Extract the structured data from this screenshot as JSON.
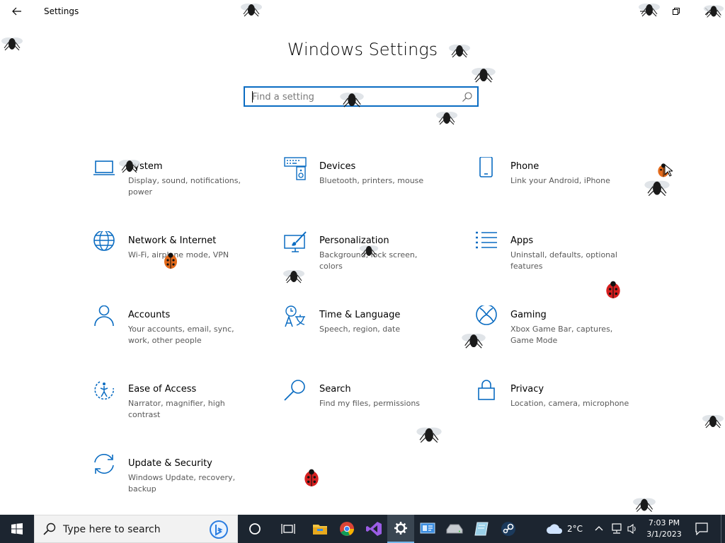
{
  "window": {
    "title": "Settings",
    "back_icon": "back-arrow-icon",
    "controls": [
      "minimize-icon",
      "restore-icon",
      "close-icon"
    ]
  },
  "main": {
    "title": "Windows Settings",
    "search": {
      "placeholder": "Find a setting",
      "value": "",
      "icon": "search-icon"
    }
  },
  "categories": [
    {
      "name": "System",
      "desc": "Display, sound, notifications, power",
      "icon": "laptop-icon"
    },
    {
      "name": "Devices",
      "desc": "Bluetooth, printers, mouse",
      "icon": "devices-icon"
    },
    {
      "name": "Phone",
      "desc": "Link your Android, iPhone",
      "icon": "phone-icon"
    },
    {
      "name": "Network & Internet",
      "desc": "Wi-Fi, airplane mode, VPN",
      "icon": "globe-icon"
    },
    {
      "name": "Personalization",
      "desc": "Background, lock screen, colors",
      "icon": "paintbrush-icon"
    },
    {
      "name": "Apps",
      "desc": "Uninstall, defaults, optional features",
      "icon": "apps-list-icon"
    },
    {
      "name": "Accounts",
      "desc": "Your accounts, email, sync, work, other people",
      "icon": "person-icon"
    },
    {
      "name": "Time & Language",
      "desc": "Speech, region, date",
      "icon": "time-language-icon"
    },
    {
      "name": "Gaming",
      "desc": "Xbox Game Bar, captures, Game Mode",
      "icon": "xbox-icon"
    },
    {
      "name": "Ease of Access",
      "desc": "Narrator, magnifier, high contrast",
      "icon": "ease-of-access-icon"
    },
    {
      "name": "Search",
      "desc": "Find my files, permissions",
      "icon": "magnifier-icon"
    },
    {
      "name": "Privacy",
      "desc": "Location, camera, microphone",
      "icon": "lock-icon"
    },
    {
      "name": "Update & Security",
      "desc": "Windows Update, recovery, backup",
      "icon": "sync-icon"
    }
  ],
  "taskbar": {
    "search_placeholder": "Type here to search",
    "pinned": [
      "cortana-icon",
      "task-view-icon",
      "file-explorer-icon",
      "chrome-icon",
      "visual-studio-icon",
      "settings-gear-icon",
      "control-panel-icon",
      "drive-icon",
      "tablet-app-icon",
      "steam-icon"
    ],
    "active": "settings-gear-icon",
    "weather": {
      "temp": "2°C",
      "icon": "cloud-icon"
    },
    "clock": {
      "time": "7:03 PM",
      "date": "3/1/2023"
    }
  },
  "colors": {
    "accent": "#0a6cc2",
    "taskbar": "#1c2530",
    "desc_text": "#595959"
  }
}
